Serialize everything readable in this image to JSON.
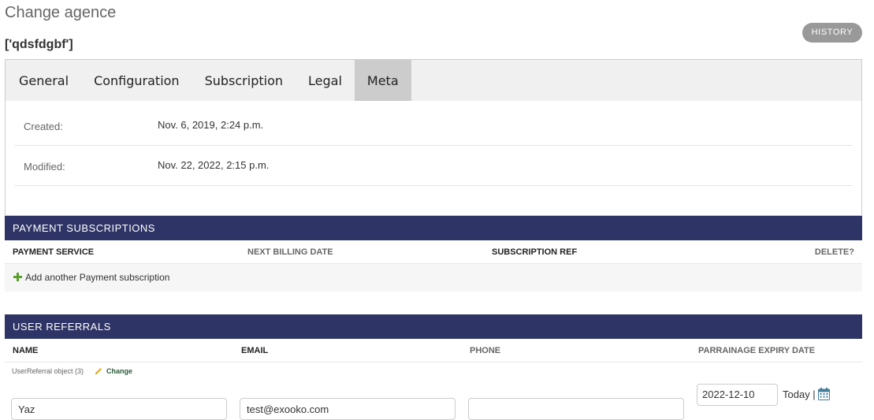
{
  "header": {
    "title": "Change agence",
    "object_name": "['qdsfdgbf']",
    "history_label": "HISTORY"
  },
  "tabs": [
    {
      "label": "General",
      "active": false
    },
    {
      "label": "Configuration",
      "active": false
    },
    {
      "label": "Subscription",
      "active": false
    },
    {
      "label": "Legal",
      "active": false
    },
    {
      "label": "Meta",
      "active": true
    }
  ],
  "meta": {
    "created_label": "Created:",
    "created_value": "Nov. 6, 2019, 2:24 p.m.",
    "modified_label": "Modified:",
    "modified_value": "Nov. 22, 2022, 2:15 p.m."
  },
  "payment_subscriptions": {
    "title": "PAYMENT SUBSCRIPTIONS",
    "columns": [
      "PAYMENT SERVICE",
      "NEXT BILLING DATE",
      "SUBSCRIPTION REF",
      "DELETE?"
    ],
    "add_label": "Add another Payment subscription"
  },
  "user_referrals": {
    "title": "USER REFERRALS",
    "columns": [
      "NAME",
      "EMAIL",
      "PHONE",
      "PARRAINAGE EXPIRY DATE"
    ],
    "object_label": "UserReferral object (3)",
    "change_label": "Change",
    "row": {
      "name": "Yaz",
      "email": "test@exooko.com",
      "phone": "",
      "expiry_date": "2022-12-10",
      "today_label": "Today |"
    }
  },
  "colors": {
    "inline_header_bg": "#2e3466",
    "active_tab_bg": "#cccccc",
    "add_icon": "#5aa02c"
  }
}
